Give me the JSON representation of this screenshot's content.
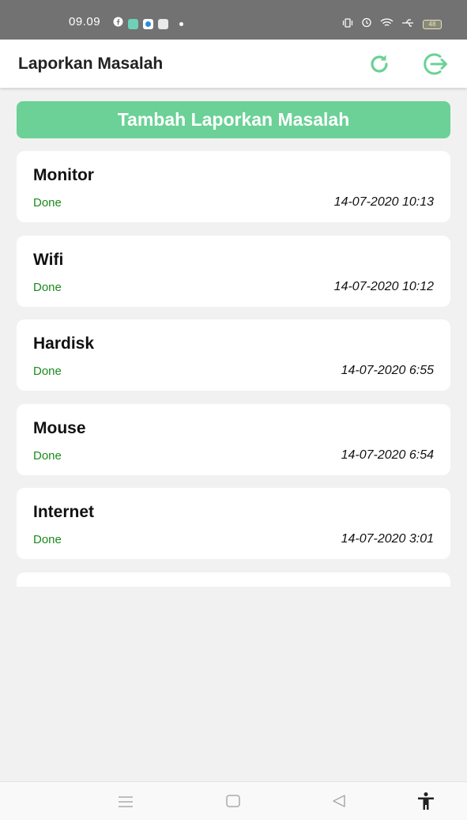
{
  "status_bar": {
    "time": "09.09",
    "battery": "48",
    "left_icons": [
      "facebook-icon",
      "app-icon",
      "messenger-icon",
      "store-icon"
    ],
    "right_icons": [
      "vibrate-icon",
      "alarm-icon",
      "wifi-icon",
      "usb-icon",
      "battery-icon"
    ]
  },
  "app_bar": {
    "title": "Laporkan Masalah",
    "actions": [
      "refresh-icon",
      "logout-icon"
    ],
    "accent_color": "#6bd196"
  },
  "add_button": {
    "label": "Tambah Laporkan Masalah"
  },
  "reports": [
    {
      "title": "Monitor",
      "status": "Done",
      "datetime": "14-07-2020 10:13"
    },
    {
      "title": "Wifi",
      "status": "Done",
      "datetime": "14-07-2020 10:12"
    },
    {
      "title": "Hardisk",
      "status": "Done",
      "datetime": "14-07-2020 6:55"
    },
    {
      "title": "Mouse",
      "status": "Done",
      "datetime": "14-07-2020 6:54"
    },
    {
      "title": "Internet",
      "status": "Done",
      "datetime": "14-07-2020 3:01"
    }
  ],
  "nav_bar": {
    "buttons": [
      "menu-icon",
      "home-icon",
      "back-icon",
      "accessibility-icon"
    ]
  }
}
